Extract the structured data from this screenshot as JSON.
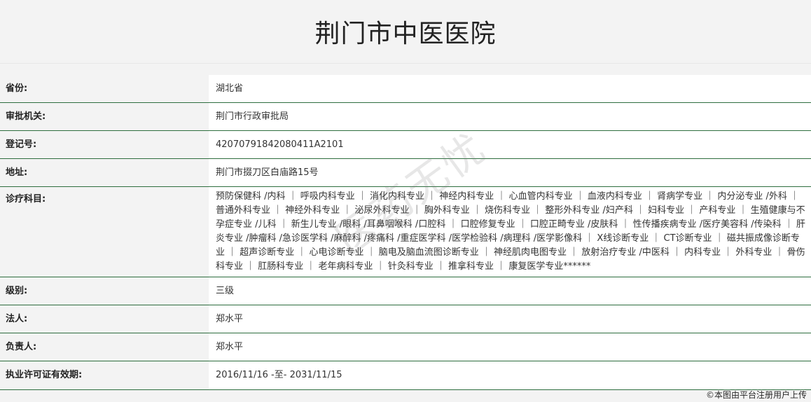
{
  "header": {
    "title": "荆门市中医医院"
  },
  "rows": [
    {
      "label": "省份:",
      "value": "湖北省"
    },
    {
      "label": "审批机关:",
      "value": "荆门市行政审批局"
    },
    {
      "label": "登记号:",
      "value": "42070791842080411A2101"
    },
    {
      "label": "地址:",
      "value": "荆门市掇刀区白庙路15号"
    },
    {
      "label": "诊疗科目:",
      "value": "预防保健科 /内科 ｜ 呼吸内科专业 ｜ 消化内科专业 ｜ 神经内科专业 ｜ 心血管内科专业 ｜ 血液内科专业 ｜ 肾病学专业 ｜ 内分泌专业 /外科 ｜ 普通外科专业 ｜ 神经外科专业 ｜ 泌尿外科专业 ｜ 胸外科专业 ｜ 烧伤科专业 ｜ 整形外科专业 /妇产科 ｜ 妇科专业 ｜ 产科专业 ｜ 生殖健康与不孕症专业 /儿科 ｜ 新生儿专业 /眼科 /耳鼻咽喉科 /口腔科 ｜ 口腔修复专业 ｜ 口腔正畸专业 /皮肤科 ｜ 性传播疾病专业 /医疗美容科 /传染科 ｜ 肝炎专业 /肿瘤科 /急诊医学科 /麻醉科 /疼痛科 /重症医学科 /医学检验科 /病理科 /医学影像科 ｜ X线诊断专业 ｜ CT诊断专业 ｜ 磁共振成像诊断专业 ｜ 超声诊断专业 ｜ 心电诊断专业 ｜ 脑电及脑血流图诊断专业 ｜ 神经肌肉电图专业 ｜ 放射治疗专业 /中医科 ｜ 内科专业 ｜ 外科专业 ｜ 骨伤科专业 ｜ 肛肠科专业 ｜ 老年病科专业 ｜ 针灸科专业 ｜ 推拿科专业 ｜ 康复医学专业******"
    },
    {
      "label": "级别:",
      "value": "三级"
    },
    {
      "label": "法人:",
      "value": "郑水平"
    },
    {
      "label": "负责人:",
      "value": "郑水平"
    },
    {
      "label": "执业许可证有效期:",
      "value": "2016/11/16 -至- 2031/11/15"
    }
  ],
  "watermark": "医药无忧",
  "copyright": "©本图由平台注册用户上传"
}
